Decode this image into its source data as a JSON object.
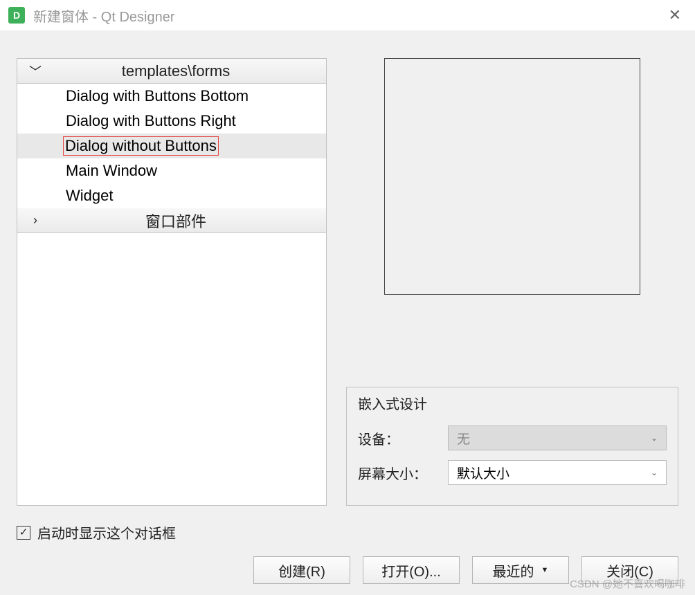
{
  "titlebar": {
    "icon_letter": "D",
    "title": "新建窗体 - Qt Designer"
  },
  "tree": {
    "groups": [
      {
        "label": "templates\\forms",
        "expanded": true,
        "items": [
          {
            "label": "Dialog with Buttons Bottom",
            "selected": false
          },
          {
            "label": "Dialog with Buttons Right",
            "selected": false
          },
          {
            "label": "Dialog without Buttons",
            "selected": true
          },
          {
            "label": "Main Window",
            "selected": false
          },
          {
            "label": "Widget",
            "selected": false
          }
        ]
      },
      {
        "label": "窗口部件",
        "expanded": false,
        "items": []
      }
    ]
  },
  "embed": {
    "title": "嵌入式设计",
    "device_label": "设备：",
    "device_value": "无",
    "screen_label": "屏幕大小：",
    "screen_value": "默认大小"
  },
  "checkbox": {
    "label": "启动时显示这个对话框",
    "checked": true
  },
  "buttons": {
    "create": "创建(R)",
    "open": "打开(O)...",
    "recent": "最近的",
    "close": "关闭(C)"
  },
  "watermark": "CSDN @她不喜欢喝咖啡"
}
